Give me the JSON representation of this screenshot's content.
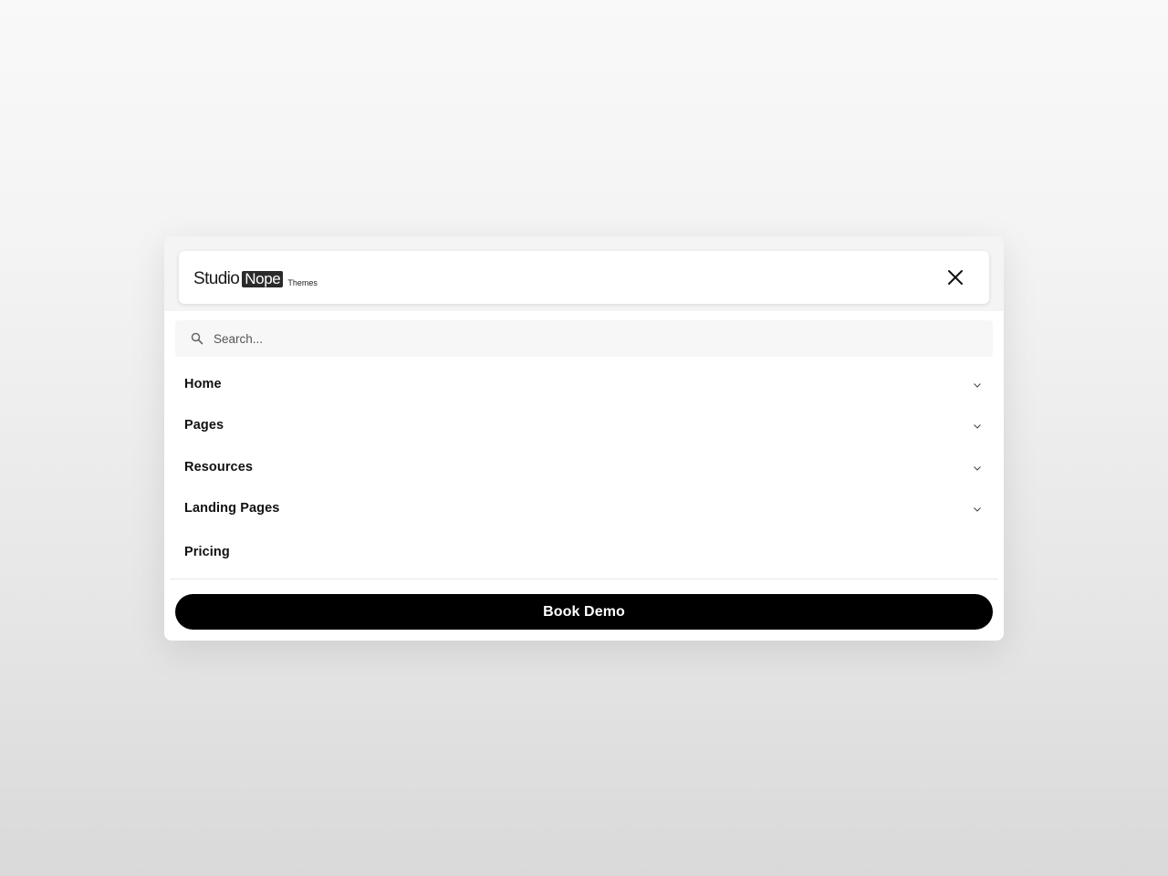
{
  "brand": {
    "name_part1": "Studio",
    "name_part2": "Nope",
    "suffix": "Themes"
  },
  "header": {
    "close_icon": "close-icon"
  },
  "search": {
    "placeholder": "Search...",
    "value": "",
    "icon": "search-icon"
  },
  "nav": {
    "items": [
      {
        "label": "Home",
        "has_submenu": true
      },
      {
        "label": "Pages",
        "has_submenu": true
      },
      {
        "label": "Resources",
        "has_submenu": true
      },
      {
        "label": "Landing Pages",
        "has_submenu": true
      },
      {
        "label": "Pricing",
        "has_submenu": false
      }
    ]
  },
  "cta": {
    "label": "Book Demo"
  },
  "colors": {
    "button_bg": "#000000",
    "button_text": "#ffffff",
    "logo_badge_bg": "#2a2a2a"
  }
}
